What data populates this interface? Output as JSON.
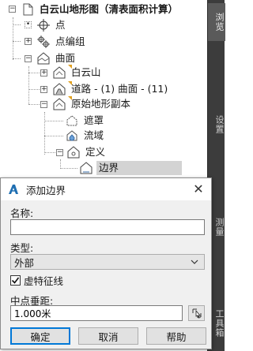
{
  "tree": {
    "items": [
      {
        "label": "白云山地形图（清表面积计算）"
      },
      {
        "label": "点"
      },
      {
        "label": "点编组"
      },
      {
        "label": "曲面"
      },
      {
        "label": "白云山"
      },
      {
        "label": "道路 - (1) 曲面 - (11)"
      },
      {
        "label": "原始地形副本"
      },
      {
        "label": "遮罩"
      },
      {
        "label": "流域"
      },
      {
        "label": "定义"
      },
      {
        "label": "边界"
      }
    ]
  },
  "side_tabs": {
    "a": "浏览",
    "b": "设置",
    "c": "测量",
    "d": "工具箱"
  },
  "dialog": {
    "title": "添加边界",
    "close_glyph": "✕",
    "name_label": "名称:",
    "name_value": "",
    "type_label": "类型:",
    "type_value": "外部",
    "checkbox_label": "虚特征线",
    "checkbox_checked": true,
    "mid_label": "中点垂距:",
    "mid_value": "1.000米",
    "ok_label": "确定",
    "cancel_label": "取消",
    "help_label": "帮助"
  },
  "colors": {
    "panel_dark": "#3c3c3c",
    "selection": "#d3d3d3",
    "accent": "#0078d7",
    "flag": "#e0a020"
  },
  "icons": {
    "dialog_logo": "autodesk-a-icon",
    "pick": "pick-from-drawing-icon",
    "dropdown": "chevron-down-icon"
  }
}
